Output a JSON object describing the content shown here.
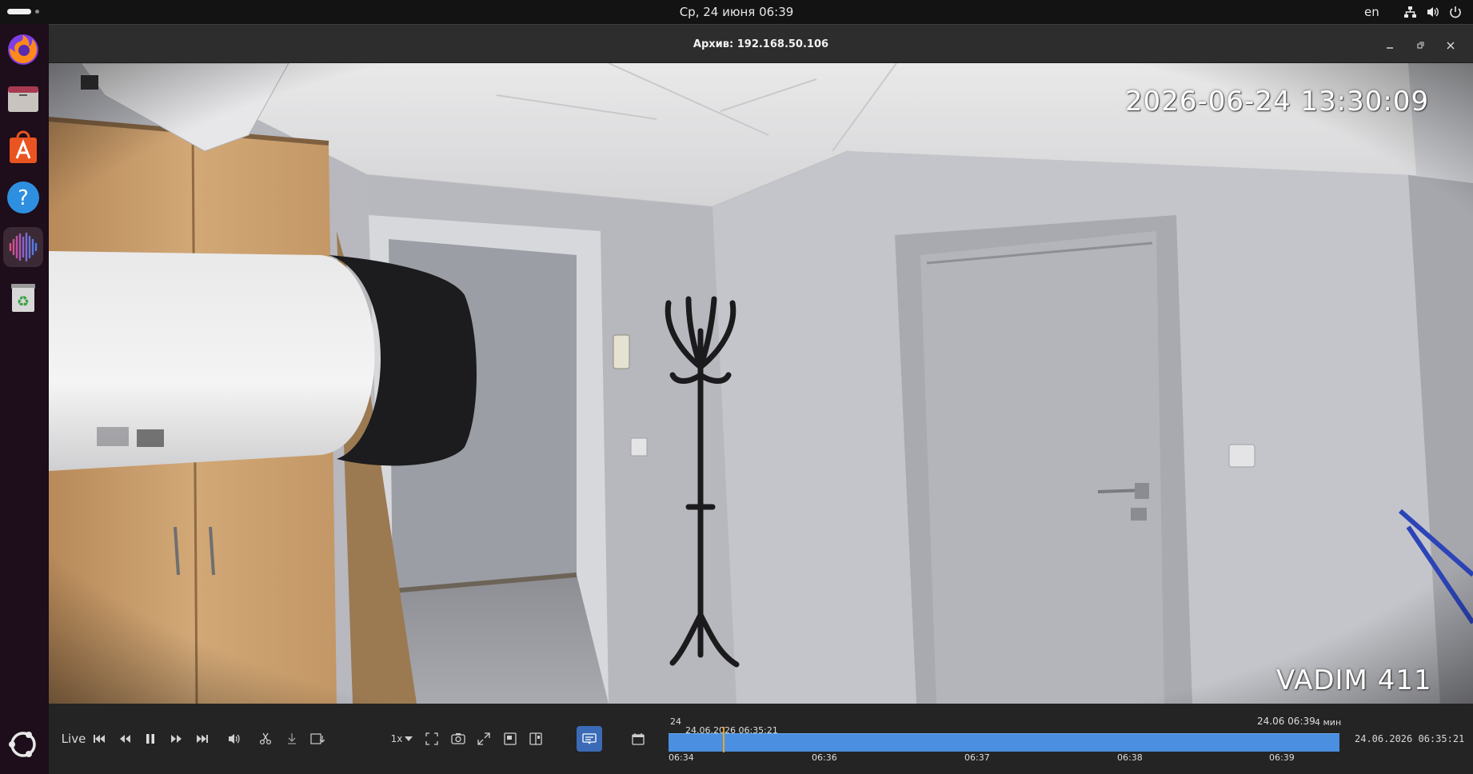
{
  "topbar": {
    "clock": "Ср, 24 июня  06:39",
    "language": "en",
    "tray_icons": [
      "network-icon",
      "volume-icon",
      "power-icon"
    ]
  },
  "dock": {
    "items": [
      {
        "name": "firefox",
        "icon": "firefox-icon"
      },
      {
        "name": "files",
        "icon": "files-icon"
      },
      {
        "name": "app-center",
        "icon": "app-center-icon"
      },
      {
        "name": "help",
        "icon": "help-icon"
      },
      {
        "name": "video-client",
        "icon": "audio-wave-icon",
        "running": true
      },
      {
        "name": "trash",
        "icon": "trash-icon"
      },
      {
        "name": "show-apps",
        "icon": "ubuntu-icon"
      }
    ]
  },
  "window": {
    "title": "Архив: 192.168.50.106",
    "buttons": [
      "minimize-icon",
      "restore-icon",
      "close-icon"
    ]
  },
  "video": {
    "osd_timestamp": "2026-06-24 13:30:09",
    "osd_camera_name": "VADIM 411"
  },
  "controls": {
    "live_label": "Live",
    "speed_label": "1x",
    "subtitles_active": true,
    "accent": "#3b6bb7"
  },
  "timeline": {
    "cut_marker_label": "24",
    "cursor_label": "24.06.2026 06:35:21",
    "end_label": "24.06 06:39",
    "scale_label": "4 мин",
    "ticks": [
      "06:34",
      "06:36",
      "06:37",
      "06:38",
      "06:39"
    ],
    "current_time": "24.06.2026 06:35:21",
    "bar_color": "#4a8fe0",
    "cursor_color": "#e8a52a"
  }
}
